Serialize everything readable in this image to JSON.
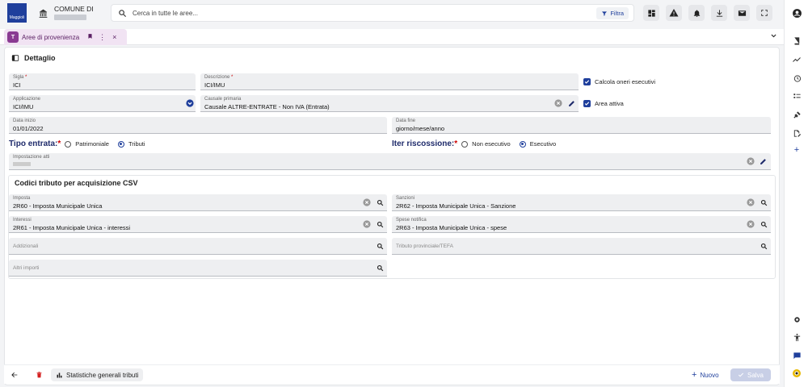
{
  "header": {
    "comune_label": "COMUNE DI",
    "logo_text": "Maggioli",
    "search_placeholder": "Cerca in tutte le aree...",
    "filter_label": "Filtra"
  },
  "tab": {
    "label": "Aree di provenienza",
    "icon_text": "T"
  },
  "section_title": "Dettaglio",
  "fields": {
    "sigla": {
      "label": "Sigla",
      "value": "ICI"
    },
    "descrizione": {
      "label": "Descrizione",
      "value": "ICI/IMU"
    },
    "applicazione": {
      "label": "Applicazione",
      "value": "ICI/IMU"
    },
    "causale": {
      "label": "Causale primaria",
      "value": "Causale ALTRE-ENTRATE - Non IVA (Entrata)"
    },
    "data_inizio": {
      "label": "Data inizio",
      "value": "01/01/2022"
    },
    "data_fine": {
      "label": "Data fine",
      "value": "giorno/mese/anno"
    },
    "impostazione": {
      "label": "Impostazione atti",
      "value": ""
    }
  },
  "checks": {
    "calcola": "Calcola oneri esecutivi",
    "attiva": "Area attiva"
  },
  "tipo_entrata": {
    "title": "Tipo entrata:",
    "opt1": "Patrimoniale",
    "opt2": "Tributi"
  },
  "iter": {
    "title": "Iter riscossione:",
    "opt1": "Non esecutivo",
    "opt2": "Esecutivo"
  },
  "csv": {
    "title": "Codici tributo per acquisizione CSV",
    "imposta": {
      "label": "Imposta",
      "value": "2R60 - Imposta Municipale Unica"
    },
    "sanzioni": {
      "label": "Sanzioni",
      "value": "2R62 - Imposta Municipale Unica - Sanzione"
    },
    "interessi": {
      "label": "Interessi",
      "value": "2R61 - Imposta Municipale Unica - interessi"
    },
    "spese": {
      "label": "Spese notifica",
      "value": "2R63 - Imposta Municipale Unica - spese"
    },
    "addizionali": {
      "placeholder": "Addizionali"
    },
    "tributo": {
      "placeholder": "Tributo provinciale/TEFA"
    },
    "altri": {
      "placeholder": "Altri importi"
    }
  },
  "footer": {
    "stat_label": "Statistiche generali tributi",
    "nuovo_label": "Nuovo",
    "salva_label": "Salva"
  },
  "colors": {
    "accent": "#1f3f9c",
    "tab_bg": "#f1e3f3",
    "tab_icon": "#8a3b92"
  }
}
